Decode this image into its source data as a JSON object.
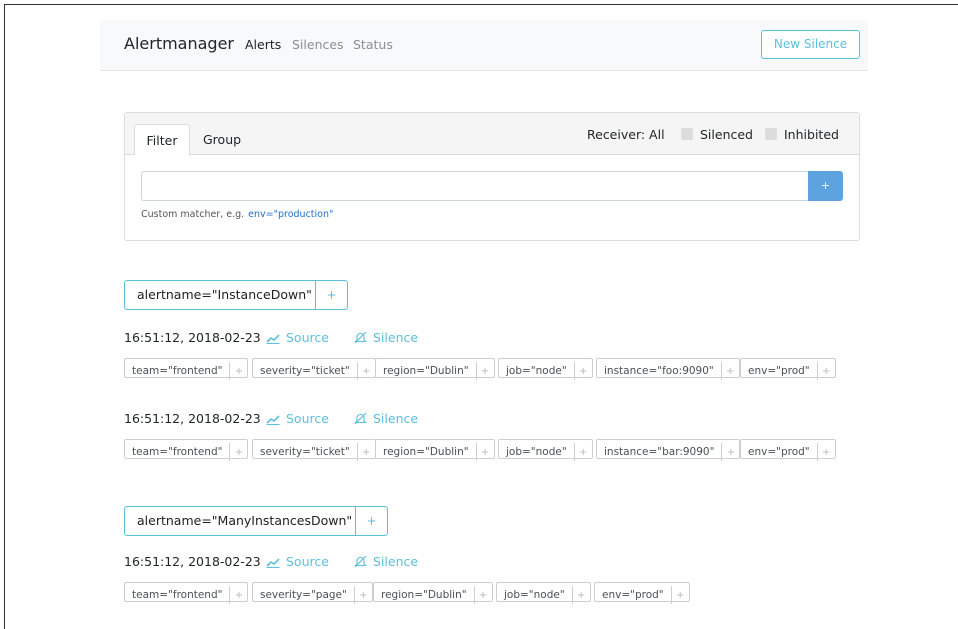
{
  "navbar": {
    "brand": "Alertmanager",
    "links": [
      "Alerts",
      "Silences",
      "Status"
    ],
    "new_silence": "New Silence"
  },
  "filter": {
    "tabs": [
      "Filter",
      "Group"
    ],
    "receiver": "Receiver: All",
    "silenced": "Silenced",
    "inhibited": "Inhibited",
    "input_value": "",
    "add_button": "+",
    "hint": "Custom matcher, e.g.",
    "hint_example": "env=\"production\""
  },
  "alert_actions": {
    "source": "Source",
    "silence": "Silence",
    "plus": "+"
  },
  "groups": [
    {
      "label": "alertname=\"InstanceDown\"",
      "alerts": [
        {
          "time": "16:51:12, 2018-02-23",
          "labels": [
            "team=\"frontend\"",
            "severity=\"ticket\"",
            "region=\"Dublin\"",
            "job=\"node\"",
            "instance=\"foo:9090\"",
            "env=\"prod\""
          ]
        },
        {
          "time": "16:51:12, 2018-02-23",
          "labels": [
            "team=\"frontend\"",
            "severity=\"ticket\"",
            "region=\"Dublin\"",
            "job=\"node\"",
            "instance=\"bar:9090\"",
            "env=\"prod\""
          ]
        }
      ]
    },
    {
      "label": "alertname=\"ManyInstancesDown\"",
      "alerts": [
        {
          "time": "16:51:12, 2018-02-23",
          "labels": [
            "team=\"frontend\"",
            "severity=\"page\"",
            "region=\"Dublin\"",
            "job=\"node\"",
            "env=\"prod\""
          ]
        }
      ]
    }
  ],
  "colors": {
    "accent": "#5bc0de",
    "primary": "#5da3e0",
    "link": "#1f6fc7"
  }
}
